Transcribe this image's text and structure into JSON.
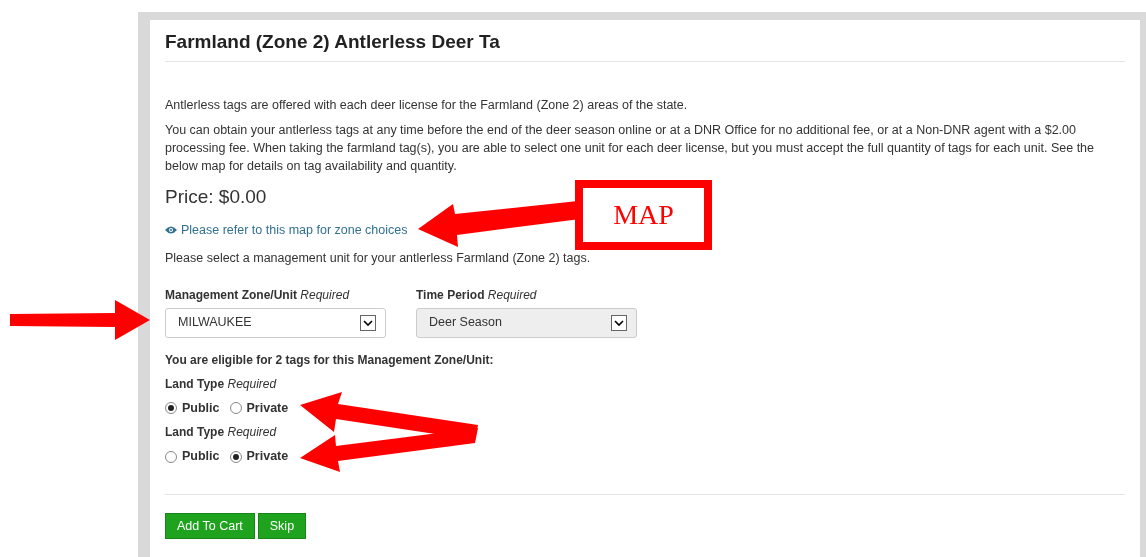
{
  "title": "Farmland (Zone 2) Antlerless Deer Ta",
  "paragraphs": [
    "Antlerless tags are offered with each deer license for the Farmland (Zone 2) areas of the state.",
    "You can obtain your antlerless tags at any time before the end of the deer season online or at a DNR Office for no additional fee, or at a Non-DNR agent with a $2.00 processing fee. When taking the farmland tag(s), you are able to select one unit for each deer license, but you must accept the full quantity of tags for each unit. See the below map for details on tag availability and quantity."
  ],
  "price": "Price: $0.00",
  "map_link": "Please refer to this map for zone choices",
  "instruction": "Please select a management unit for your antlerless Farmland (Zone 2) tags.",
  "selects": [
    {
      "label": "Management Zone/Unit",
      "required": "Required",
      "value": "MILWAUKEE",
      "disabled": false
    },
    {
      "label": "Time Period",
      "required": "Required",
      "value": "Deer Season",
      "disabled": true
    }
  ],
  "eligibility": "You are eligible for 2 tags for this Management Zone/Unit:",
  "land_types": [
    {
      "label": "Land Type",
      "required": "Required",
      "options": [
        {
          "label": "Public",
          "selected": true
        },
        {
          "label": "Private",
          "selected": false
        }
      ]
    },
    {
      "label": "Land Type",
      "required": "Required",
      "options": [
        {
          "label": "Public",
          "selected": false
        },
        {
          "label": "Private",
          "selected": true
        }
      ]
    }
  ],
  "buttons": [
    "Add To Cart",
    "Skip"
  ],
  "annotation": {
    "box_text": "MAP"
  }
}
